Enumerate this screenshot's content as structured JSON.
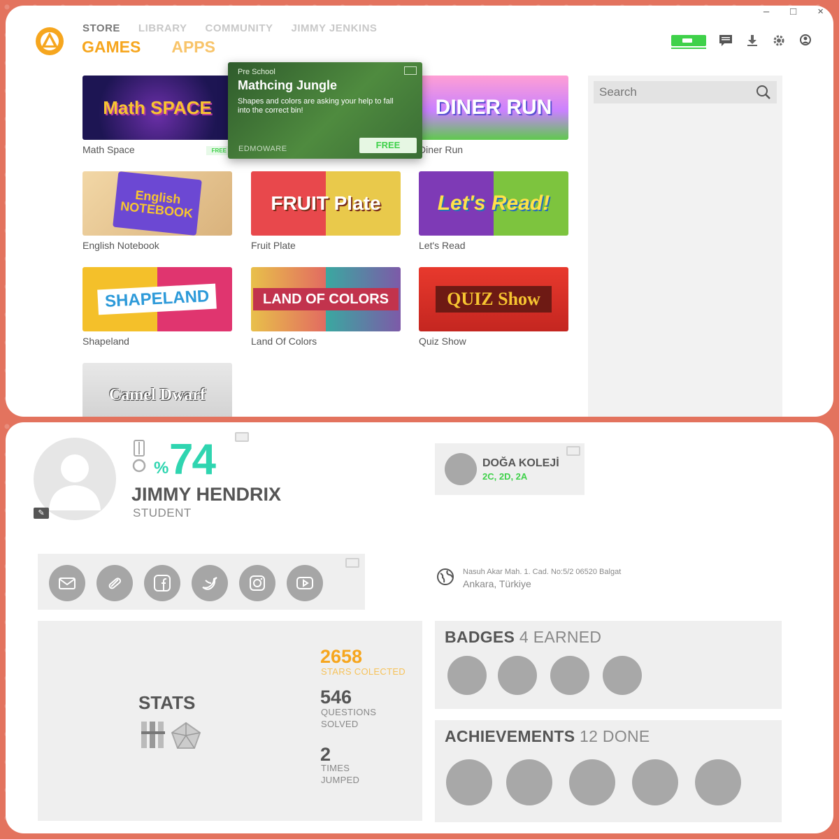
{
  "window_controls": [
    "–",
    "□",
    "×"
  ],
  "nav": {
    "top_items": [
      "STORE",
      "LIBRARY",
      "COMMUNITY",
      "JIMMY JENKINS"
    ],
    "sub_items": [
      "GAMES",
      "APPS"
    ]
  },
  "toolbar_icons": [
    "battery-icon",
    "chat-icon",
    "download-icon",
    "settings-icon",
    "user-icon"
  ],
  "search": {
    "placeholder": "Search"
  },
  "games": [
    {
      "label": "Math Space",
      "thumb_text": "Math SPACE",
      "free": "FREE"
    },
    {
      "label": "Diner Run",
      "thumb_text": "DINER RUN"
    },
    {
      "label": "English Notebook",
      "thumb_text": "English NOTEBOOK"
    },
    {
      "label": "Fruit Plate",
      "thumb_text": "FRUIT Plate"
    },
    {
      "label": "Let's Read",
      "thumb_text": "Let's Read!"
    },
    {
      "label": "Shapeland",
      "thumb_text": "SHAPELAND"
    },
    {
      "label": "Land Of Colors",
      "thumb_text": "LAND OF COLORS"
    },
    {
      "label": "Quiz Show",
      "thumb_text": "QUIZ Show"
    },
    {
      "label": "",
      "thumb_text": "Camel Dwarf"
    }
  ],
  "popup": {
    "category": "Pre School",
    "title": "Mathcing Jungle",
    "description": "Shapes and colors are asking your help to fall into the correct bin!",
    "publisher": "EDMOWARE",
    "price": "FREE"
  },
  "profile": {
    "percent_symbol": "%",
    "percent": "74",
    "name": "JIMMY HENDRIX",
    "role": "STUDENT",
    "school_name": "DOĞA KOLEJİ",
    "school_classes": "2C, 2D, 2A",
    "address_line1": "Nasuh Akar Mah. 1. Cad. No:5/2 06520 Balgat",
    "address_line2": "Ankara, Türkiye",
    "social": [
      "mail-icon",
      "link-icon",
      "facebook-icon",
      "twitter-icon",
      "instagram-icon",
      "youtube-icon"
    ]
  },
  "stats": {
    "title": "STATS",
    "stars": "2658",
    "stars_caption": "STARS COLECTED",
    "questions": "546",
    "questions_caption_1": "QUESTIONS",
    "questions_caption_2": "SOLVED",
    "jumped": "2",
    "jumped_caption_1": "TIMES",
    "jumped_caption_2": "JUMPED"
  },
  "badges": {
    "label": "BADGES",
    "count_text": "4 EARNED",
    "count": 4
  },
  "achievements": {
    "label": "ACHIEVEMENTS",
    "count_text": "12 DONE",
    "shown": 5
  },
  "colors": {
    "accent_orange": "#f6a61e",
    "accent_teal": "#2fd5b0",
    "accent_green": "#3fd14a",
    "background": "#e3735e"
  }
}
